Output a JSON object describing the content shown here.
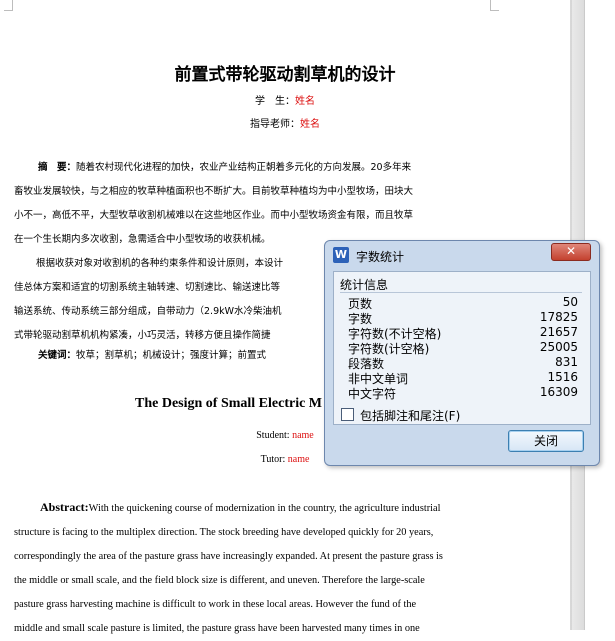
{
  "document": {
    "title": "前置式带轮驱动割草机的设计",
    "student_label": "学　生：",
    "student_name": "姓名",
    "advisor_label": "指导老师：",
    "advisor_name": "姓名",
    "abstract_label": "摘　要：",
    "abstract_lines": [
      "随着农村现代化进程的加快，农业产业结构正朝着多元化的方向发展。20多年来",
      "畜牧业发展较快，与之相应的牧草种植面积也不断扩大。目前牧草种植均为中小型牧场，田块大",
      "小不一，高低不平，大型牧草收割机械难以在这些地区作业。而中小型牧场资金有限，而且牧草",
      "在一个生长期内多次收割，急需适合中小型牧场的收获机械。"
    ],
    "para2_lines": [
      "根据收获对象对收割机的各种约束条件和设计原则，本设计",
      "佳总体方案和适宜的切割系统主轴转速、切割速比、输送速比等",
      "输送系统、传动系统三部分组成，自带动力（2.9kW水冷柴油机",
      "式带轮驱动割草机机构紧凑，小巧灵活，转移方便且操作简捷"
    ],
    "keywords_label": "关键词：",
    "keywords": "牧草；割草机；机械设计；强度计算；前置式",
    "en_title": "The Design of Small Electric M",
    "en_student_label": "Student: ",
    "en_student_name": "name",
    "en_tutor_label": "Tutor: ",
    "en_tutor_name": "name",
    "en_abstract_label": "Abstract:",
    "en_abstract_lines": [
      "With the quickening course of modernization in the country, the agriculture industrial",
      "structure is facing to the multiplex direction. The stock breeding have developed quickly for 20 years,",
      "correspondingly the area of the pasture grass have increasingly expanded. At present the pasture grass is",
      "the middle or small scale, and the field block size is different, and uneven. Therefore the large-scale",
      "pasture grass harvesting machine is difficult to work in these local areas. However the fund of the",
      "middle and small scale pasture is limited, the pasture grass have been harvested many times in one"
    ]
  },
  "dialog": {
    "icon_glyph": "W",
    "title": "字数统计",
    "close_glyph": "✕",
    "section_header": "统计信息",
    "stats": [
      {
        "label": "页数",
        "value": "50"
      },
      {
        "label": "字数",
        "value": "17825"
      },
      {
        "label": "字符数(不计空格)",
        "value": "21657"
      },
      {
        "label": "字符数(计空格)",
        "value": "25005"
      },
      {
        "label": "段落数",
        "value": "831"
      },
      {
        "label": "非中文单词",
        "value": "1516"
      },
      {
        "label": "中文字符",
        "value": "16309"
      }
    ],
    "checkbox_label": "包括脚注和尾注(F)",
    "checkbox_checked": false,
    "ok_label": "关闭"
  },
  "colors": {
    "accent_red": "#dd1111",
    "dialog_bg": "#c9d9ec",
    "close_red": "#c3412f"
  }
}
